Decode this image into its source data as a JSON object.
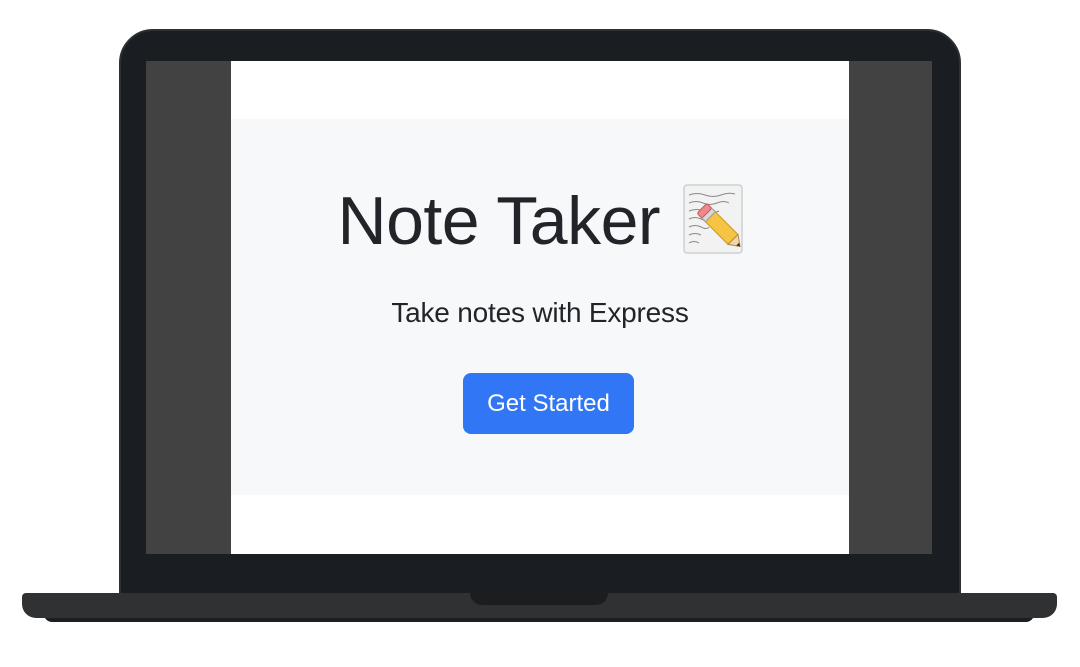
{
  "jumbotron": {
    "title": "Note Taker",
    "title_icon": "memo-icon",
    "subtitle": "Take notes with Express",
    "cta_label": "Get Started"
  },
  "colors": {
    "primary_button": "#3176f4",
    "jumbotron_bg": "#f7f8fa",
    "bezel": "#1a1e22",
    "screen_margin": "#424242",
    "text": "#212529"
  }
}
